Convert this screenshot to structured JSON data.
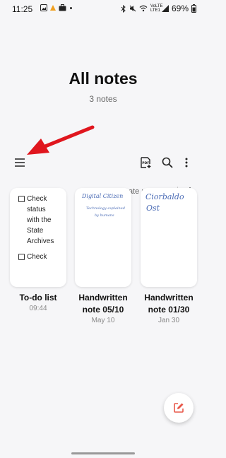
{
  "status_bar": {
    "time": "11:25",
    "battery": "69%",
    "network_label": "VoLTE LTE1"
  },
  "header": {
    "title": "All notes",
    "count": "3 notes"
  },
  "toolbar": {
    "menu_icon": "hamburger-menu-icon",
    "pdf_icon": "pdf-import-icon",
    "search_icon": "search-icon",
    "more_icon": "more-vertical-icon"
  },
  "sort": {
    "label": "Date modified",
    "direction_icon": "arrow-down-icon"
  },
  "notes": [
    {
      "title": "To-do list",
      "date": "09:44",
      "preview_lines": [
        "Check",
        "status",
        "with the",
        "State",
        "Archives",
        "Check"
      ]
    },
    {
      "title": "Handwritten note 05/10",
      "title_line1": "Handwritten",
      "title_line2": "note 05/10",
      "date": "May 10",
      "handwriting_line1": "Digital Citizen",
      "handwriting_line2": "Technology explained",
      "handwriting_line3": "by humans"
    },
    {
      "title": "Handwritten note 01/30",
      "title_line1": "Handwritten",
      "title_line2": "note 01/30",
      "date": "Jan 30",
      "handwriting_line1": "Ciorbaldo",
      "handwriting_line2": "Ost"
    }
  ],
  "colors": {
    "background": "#f6f6f8",
    "annotation_arrow": "#e0161e",
    "fab_icon": "#e8584a",
    "handwriting": "#4a6bb5"
  }
}
